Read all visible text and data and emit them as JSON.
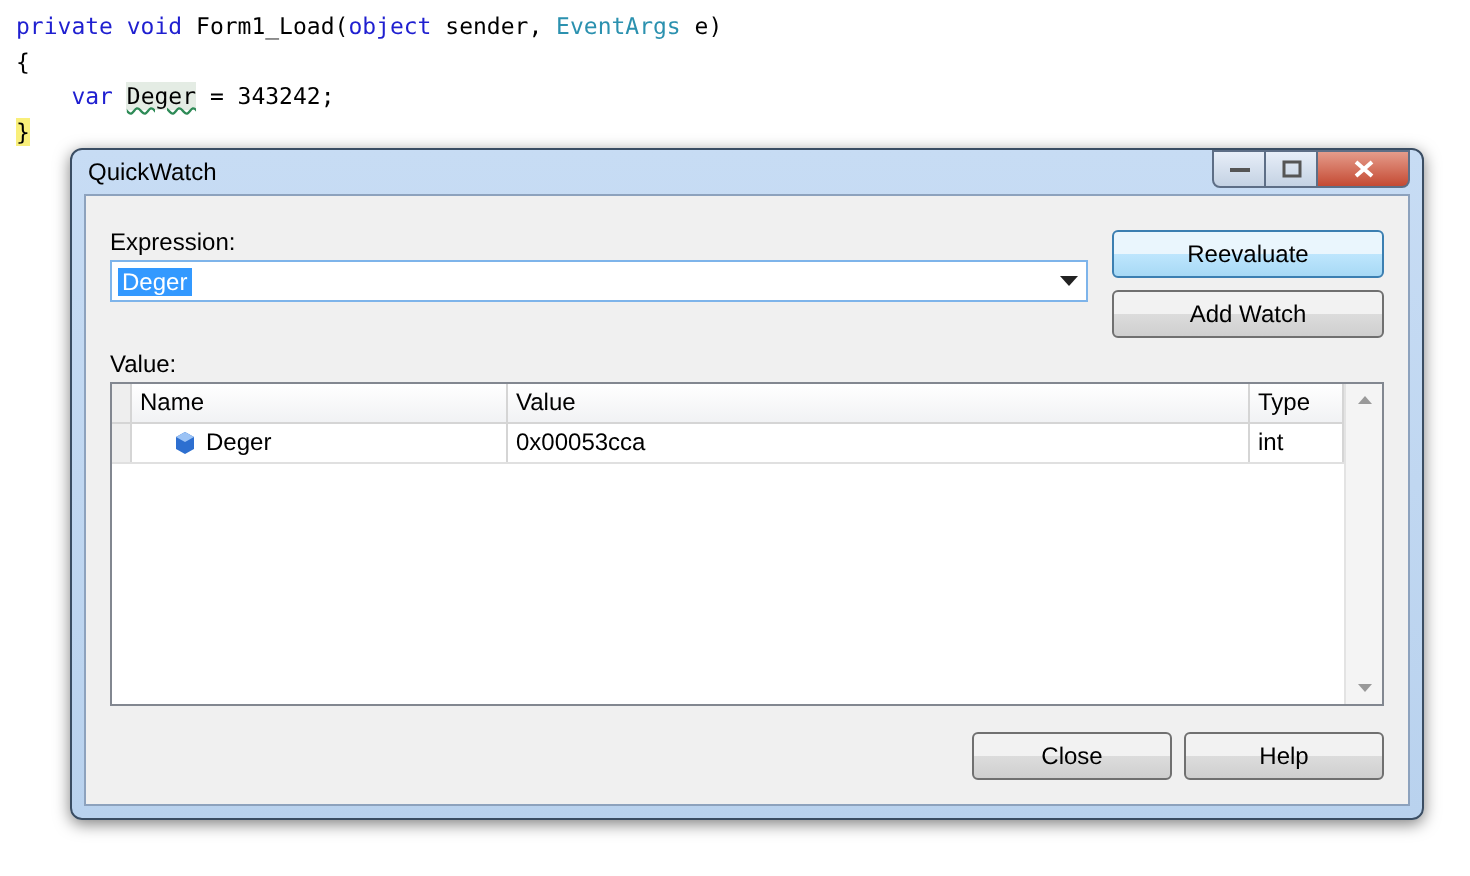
{
  "code_lines": [
    {
      "tokens": [
        {
          "text": "private void",
          "kind": "keyword"
        },
        {
          "text": " Form1_Load(",
          "kind": "plain"
        },
        {
          "text": "object",
          "kind": "keyword"
        },
        {
          "text": " sender, ",
          "kind": "plain"
        },
        {
          "text": "EventArgs",
          "kind": "type"
        },
        {
          "text": " e)",
          "kind": "plain"
        }
      ]
    },
    {
      "tokens": [
        {
          "text": "{",
          "kind": "plain"
        }
      ]
    },
    {
      "tokens": [
        {
          "text": "    var ",
          "kind": "keyword"
        },
        {
          "text": "Deger",
          "kind": "squiggle"
        },
        {
          "text": " = 343242;",
          "kind": "plain"
        }
      ]
    },
    {
      "tokens": [
        {
          "text": "}",
          "kind": "highlight"
        }
      ]
    }
  ],
  "window": {
    "title": "QuickWatch"
  },
  "expression": {
    "label": "Expression:",
    "value": "Deger",
    "text_selected": true
  },
  "buttons": [
    {
      "label": "Reevaluate",
      "focused": true
    },
    {
      "label": "Add Watch",
      "focused": false
    }
  ],
  "value_label": "Value:",
  "table": {
    "columns": [
      "Name",
      "Value",
      "Type"
    ],
    "rows": [
      {
        "name": "Deger",
        "value": "0x00053cca",
        "type": "int"
      }
    ]
  },
  "footer_buttons": [
    "Close",
    "Help"
  ]
}
